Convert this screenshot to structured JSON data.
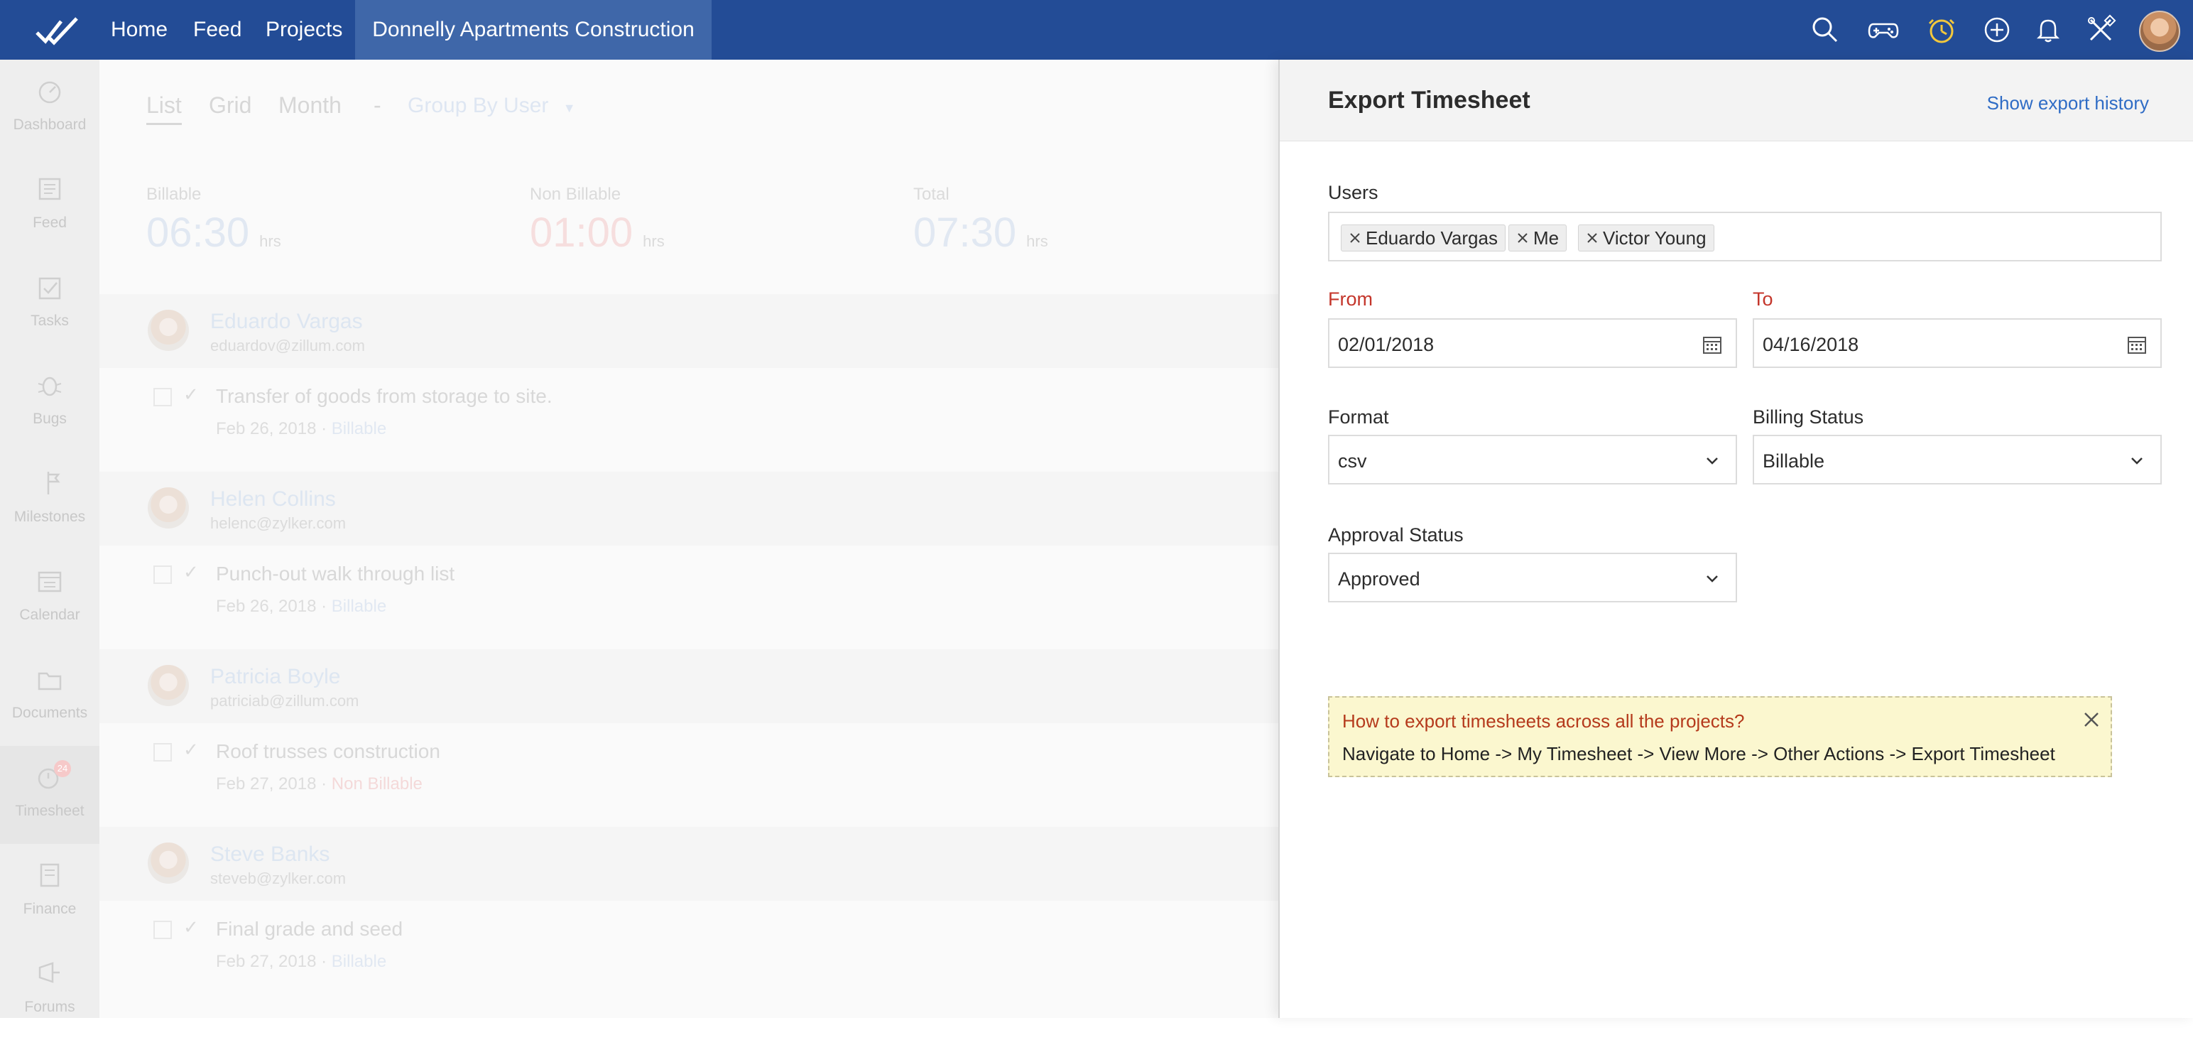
{
  "topbar": {
    "nav": [
      "Home",
      "Feed",
      "Projects"
    ],
    "active_project": "Donnelly Apartments Construction",
    "icons": [
      "search-icon",
      "gamepad-icon",
      "timer-icon",
      "plus-circle-icon",
      "bell-icon",
      "tools-icon"
    ],
    "timer_icon_color": "#f3c83c",
    "brand_color": "#234c96"
  },
  "sidebar": {
    "items": [
      {
        "label": "Dashboard",
        "icon": "dashboard-icon"
      },
      {
        "label": "Feed",
        "icon": "feed-icon"
      },
      {
        "label": "Tasks",
        "icon": "tasks-icon"
      },
      {
        "label": "Bugs",
        "icon": "bug-icon"
      },
      {
        "label": "Milestones",
        "icon": "milestone-icon"
      },
      {
        "label": "Calendar",
        "icon": "calendar-icon"
      },
      {
        "label": "Documents",
        "icon": "folder-icon"
      },
      {
        "label": "Timesheet",
        "icon": "timesheet-icon",
        "badge": "24"
      },
      {
        "label": "Finance",
        "icon": "finance-icon"
      },
      {
        "label": "Forums",
        "icon": "forums-icon"
      }
    ]
  },
  "timesheet": {
    "tabs": [
      "List",
      "Grid",
      "Month"
    ],
    "separator": "-",
    "group_by": "Group By User",
    "stats": [
      {
        "label": "Billable",
        "value": "06:30",
        "unit": "hrs"
      },
      {
        "label": "Non Billable",
        "value": "01:00",
        "unit": "hrs"
      },
      {
        "label": "Total",
        "value": "07:30",
        "unit": "hrs"
      }
    ],
    "entries": [
      {
        "user": "Eduardo Vargas",
        "email": "eduardov@zillum.com",
        "task": "Transfer of goods from storage to site.",
        "date": "Feb 26, 2018",
        "status": "Billable"
      },
      {
        "user": "Helen Collins",
        "email": "helenc@zylker.com",
        "task": "Punch-out walk through list",
        "date": "Feb 26, 2018",
        "status": "Billable"
      },
      {
        "user": "Patricia Boyle",
        "email": "patriciab@zillum.com",
        "task": "Roof trusses construction",
        "date": "Feb 27, 2018",
        "status": "Non Billable"
      },
      {
        "user": "Steve Banks",
        "email": "steveb@zylker.com",
        "task": "Final grade and seed",
        "date": "Feb 27, 2018",
        "status": "Billable"
      }
    ],
    "dot": "·"
  },
  "export_panel": {
    "title": "Export Timesheet",
    "history_link": "Show export history",
    "users_label": "Users",
    "users": [
      "Eduardo Vargas",
      "Me",
      "Victor Young"
    ],
    "from_label": "From",
    "from_value": "02/01/2018",
    "to_label": "To",
    "to_value": "04/16/2018",
    "format_label": "Format",
    "format_value": "csv",
    "billing_label": "Billing Status",
    "billing_value": "Billable",
    "approval_label": "Approval Status",
    "approval_value": "Approved",
    "tip_question": "How to export timesheets across all the projects?",
    "tip_answer": "Navigate to Home -> My Timesheet -> View More -> Other Actions -> Export Timesheet"
  }
}
